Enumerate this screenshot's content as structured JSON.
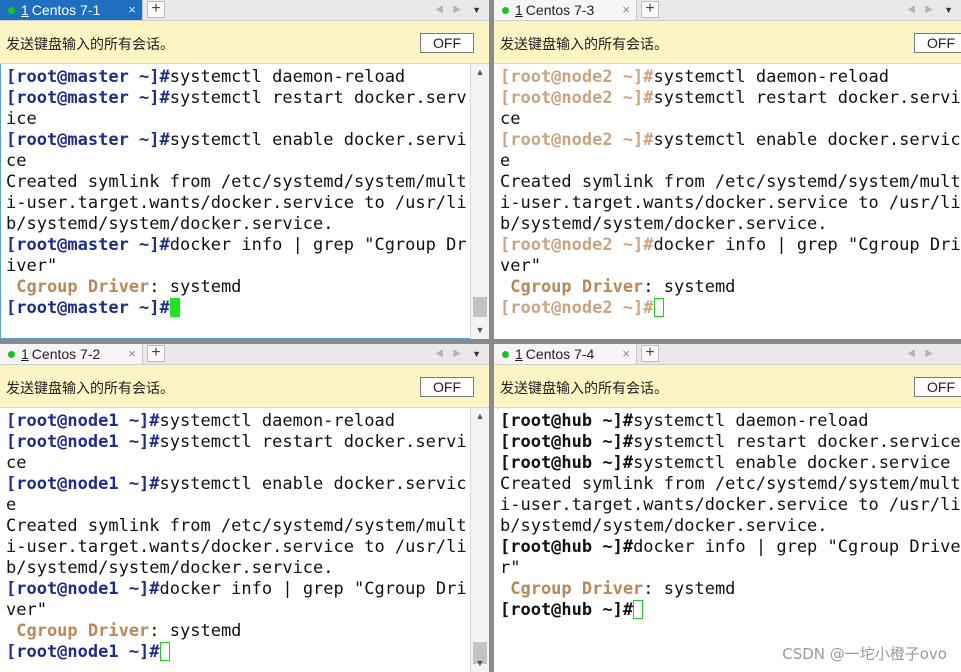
{
  "panes": [
    {
      "tab": {
        "num": "1",
        "name": "Centos 7-1",
        "close": "×"
      },
      "banner": "发送键盘输入的所有会话。",
      "off": "OFF",
      "lines": [
        [
          "[root@master ~]#",
          "systemctl daemon-reload"
        ],
        [
          "[root@master ~]#",
          "systemctl restart docker.serv"
        ],
        [
          "",
          "ice"
        ],
        [
          "[root@master ~]#",
          "systemctl enable docker.servi"
        ],
        [
          "",
          "ce"
        ],
        [
          "",
          "Created symlink from /etc/systemd/system/mult"
        ],
        [
          "",
          "i-user.target.wants/docker.service to /usr/li"
        ],
        [
          "",
          "b/systemd/system/docker.service."
        ],
        [
          "[root@master ~]#",
          "docker info | grep \"Cgroup Dr"
        ],
        [
          "",
          "iver\""
        ],
        [
          " Cgroup Driver",
          ": systemd"
        ],
        [
          "[root@master ~]#",
          ""
        ]
      ]
    },
    {
      "tab": {
        "num": "1",
        "name": "Centos 7-3",
        "close": "×"
      },
      "banner": "发送键盘输入的所有会话。",
      "off": "OFF",
      "lines": [
        [
          "[root@node2 ~]#",
          "systemctl daemon-reload"
        ],
        [
          "[root@node2 ~]#",
          "systemctl restart docker.servi"
        ],
        [
          "",
          "ce"
        ],
        [
          "[root@node2 ~]#",
          "systemctl enable docker.servic"
        ],
        [
          "",
          "e"
        ],
        [
          "",
          "Created symlink from /etc/systemd/system/mult"
        ],
        [
          "",
          "i-user.target.wants/docker.service to /usr/li"
        ],
        [
          "",
          "b/systemd/system/docker.service."
        ],
        [
          "[root@node2 ~]#",
          "docker info | grep \"Cgroup Dri"
        ],
        [
          "",
          "ver\""
        ],
        [
          " Cgroup Driver",
          ": systemd"
        ],
        [
          "[root@node2 ~]#",
          ""
        ]
      ]
    },
    {
      "tab": {
        "num": "1",
        "name": "Centos 7-2",
        "close": "×"
      },
      "banner": "发送键盘输入的所有会话。",
      "off": "OFF",
      "lines": [
        [
          "[root@node1 ~]#",
          "systemctl daemon-reload"
        ],
        [
          "[root@node1 ~]#",
          "systemctl restart docker.servi"
        ],
        [
          "",
          "ce"
        ],
        [
          "[root@node1 ~]#",
          "systemctl enable docker.servic"
        ],
        [
          "",
          "e"
        ],
        [
          "",
          "Created symlink from /etc/systemd/system/mult"
        ],
        [
          "",
          "i-user.target.wants/docker.service to /usr/li"
        ],
        [
          "",
          "b/systemd/system/docker.service."
        ],
        [
          "[root@node1 ~]#",
          "docker info | grep \"Cgroup Dri"
        ],
        [
          "",
          "ver\""
        ],
        [
          " Cgroup Driver",
          ": systemd"
        ],
        [
          "[root@node1 ~]#",
          ""
        ]
      ]
    },
    {
      "tab": {
        "num": "1",
        "name": "Centos 7-4",
        "close": "×"
      },
      "banner": "发送键盘输入的所有会话。",
      "off": "OFF",
      "lines": [
        [
          "[root@hub ~]#",
          "systemctl daemon-reload"
        ],
        [
          "[root@hub ~]#",
          "systemctl restart docker.service"
        ],
        [
          "[root@hub ~]#",
          "systemctl enable docker.service"
        ],
        [
          "",
          "Created symlink from /etc/systemd/system/mult"
        ],
        [
          "",
          "i-user.target.wants/docker.service to /usr/li"
        ],
        [
          "",
          "b/systemd/system/docker.service."
        ],
        [
          "[root@hub ~]#",
          "docker info | grep \"Cgroup Drive"
        ],
        [
          "",
          "r\""
        ],
        [
          " Cgroup Driver",
          ": systemd"
        ],
        [
          "[root@hub ~]#",
          ""
        ]
      ]
    }
  ],
  "tabbar_controls": {
    "add": "+",
    "prev": "◀",
    "next": "▶",
    "menu": "▼"
  },
  "scroll_arrows": {
    "up": "▲",
    "down": "▼"
  },
  "watermark": "CSDN @一坨小橙子ovo"
}
